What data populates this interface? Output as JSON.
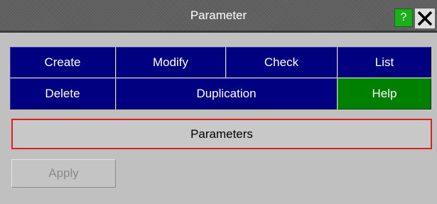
{
  "window": {
    "title": "Parameter",
    "help_label": "?",
    "close_icon": "close-icon"
  },
  "buttons": {
    "create": "Create",
    "modify": "Modify",
    "check": "Check",
    "list": "List",
    "delete": "Delete",
    "duplication": "Duplication",
    "help": "Help"
  },
  "parameters_field": {
    "label": "Parameters"
  },
  "apply": {
    "label": "Apply",
    "enabled": false
  },
  "colors": {
    "button_blue": "#000080",
    "button_green": "#008000",
    "title_help_green": "#19b019",
    "field_border_red": "#e02020",
    "background": "#c0c0c0"
  }
}
